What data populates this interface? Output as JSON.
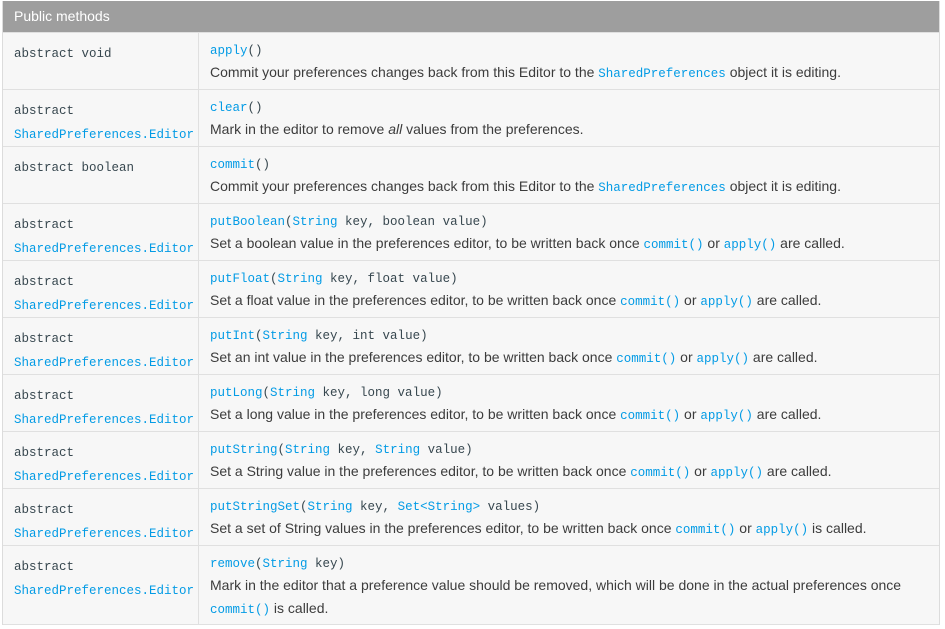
{
  "header": {
    "title": "Public methods"
  },
  "rows": [
    {
      "type_kw": "abstract void",
      "type_link": "",
      "method": "apply",
      "params_prefix": "()",
      "params": [],
      "desc_parts": [
        "Commit your preferences changes back from this Editor to the ",
        "SharedPreferences",
        " object it is editing."
      ]
    },
    {
      "type_kw": "abstract",
      "type_link": "SharedPreferences.Editor",
      "method": "clear",
      "params_prefix": "()",
      "desc_parts": [
        "Mark in the editor to remove ",
        "all",
        " values from the preferences."
      ]
    },
    {
      "type_kw": "abstract boolean",
      "type_link": "",
      "method": "commit",
      "params_prefix": "()",
      "desc_parts": [
        "Commit your preferences changes back from this Editor to the ",
        "SharedPreferences",
        " object it is editing."
      ]
    },
    {
      "type_kw": "abstract",
      "type_link": "SharedPreferences.Editor",
      "method": "putBoolean",
      "param1_type": "String",
      "param1_rest": " key, boolean value)",
      "desc_parts": [
        "Set a boolean value in the preferences editor, to be written back once ",
        "commit()",
        " or ",
        "apply()",
        " are called."
      ]
    },
    {
      "type_kw": "abstract",
      "type_link": "SharedPreferences.Editor",
      "method": "putFloat",
      "param1_type": "String",
      "param1_rest": " key, float value)",
      "desc_parts": [
        "Set a float value in the preferences editor, to be written back once ",
        "commit()",
        " or ",
        "apply()",
        " are called."
      ]
    },
    {
      "type_kw": "abstract",
      "type_link": "SharedPreferences.Editor",
      "method": "putInt",
      "param1_type": "String",
      "param1_rest": " key, int value)",
      "desc_parts": [
        "Set an int value in the preferences editor, to be written back once ",
        "commit()",
        " or ",
        "apply()",
        " are called."
      ]
    },
    {
      "type_kw": "abstract",
      "type_link": "SharedPreferences.Editor",
      "method": "putLong",
      "param1_type": "String",
      "param1_rest": " key, long value)",
      "desc_parts": [
        "Set a long value in the preferences editor, to be written back once ",
        "commit()",
        " or ",
        "apply()",
        " are called."
      ]
    },
    {
      "type_kw": "abstract",
      "type_link": "SharedPreferences.Editor",
      "method": "putString",
      "param1_type": "String",
      "param1_mid": " key, ",
      "param2_type": "String",
      "param2_rest": " value)",
      "desc_parts": [
        "Set a String value in the preferences editor, to be written back once ",
        "commit()",
        " or ",
        "apply()",
        " are called."
      ]
    },
    {
      "type_kw": "abstract",
      "type_link": "SharedPreferences.Editor",
      "method": "putStringSet",
      "param1_type": "String",
      "param1_mid": " key, ",
      "param2_type": "Set<String>",
      "param2_rest": " values)",
      "desc_parts": [
        "Set a set of String values in the preferences editor, to be written back once ",
        "commit()",
        " or ",
        "apply()",
        " is called."
      ]
    },
    {
      "type_kw": "abstract",
      "type_link": "SharedPreferences.Editor",
      "method": "remove",
      "param1_type": "String",
      "param1_rest": " key)",
      "desc_parts": [
        "Mark in the editor that a preference value should be removed, which will be done in the actual preferences once ",
        "commit()",
        " is called."
      ]
    }
  ],
  "colors": {
    "header_bg": "#9e9e9e",
    "link": "#039be5",
    "row_bg": "#f7f7f7"
  }
}
